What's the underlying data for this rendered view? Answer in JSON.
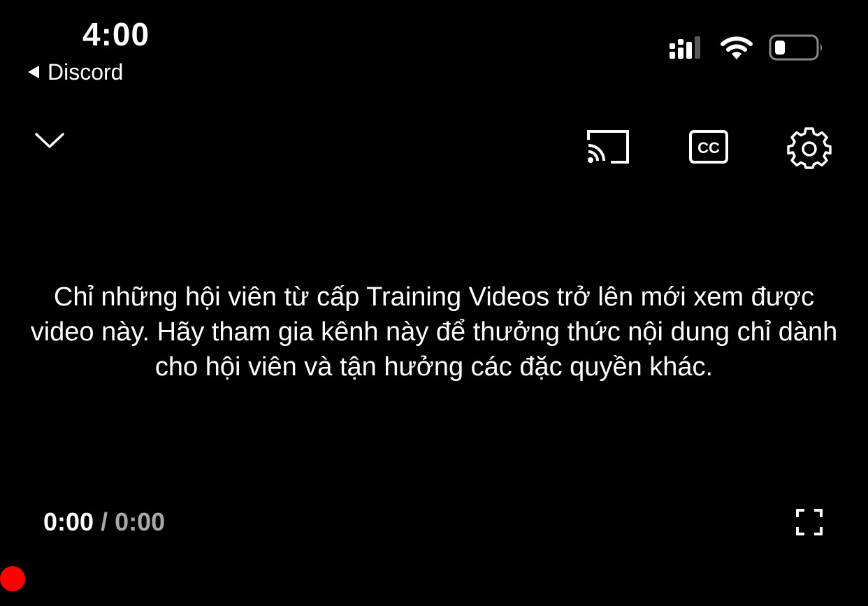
{
  "status_bar": {
    "time": "4:00",
    "back_app_label": "Discord",
    "icons": [
      "cellular-signal-icon",
      "wifi-icon",
      "battery-icon"
    ]
  },
  "player": {
    "top_controls": [
      "chevron-down-icon",
      "cast-icon",
      "closed-captions-icon",
      "gear-icon"
    ],
    "cc_label": "CC",
    "message": "Chỉ những hội viên từ cấp Training Videos trở lên mới xem được video này. Hãy tham gia kênh này để thưởng thức nội dung chỉ dành cho hội viên và tận hưởng các đặc quyền khác.",
    "current_time": "0:00",
    "time_separator": "/",
    "total_time": "0:00",
    "progress": 0,
    "accent_color": "#ff0000"
  }
}
